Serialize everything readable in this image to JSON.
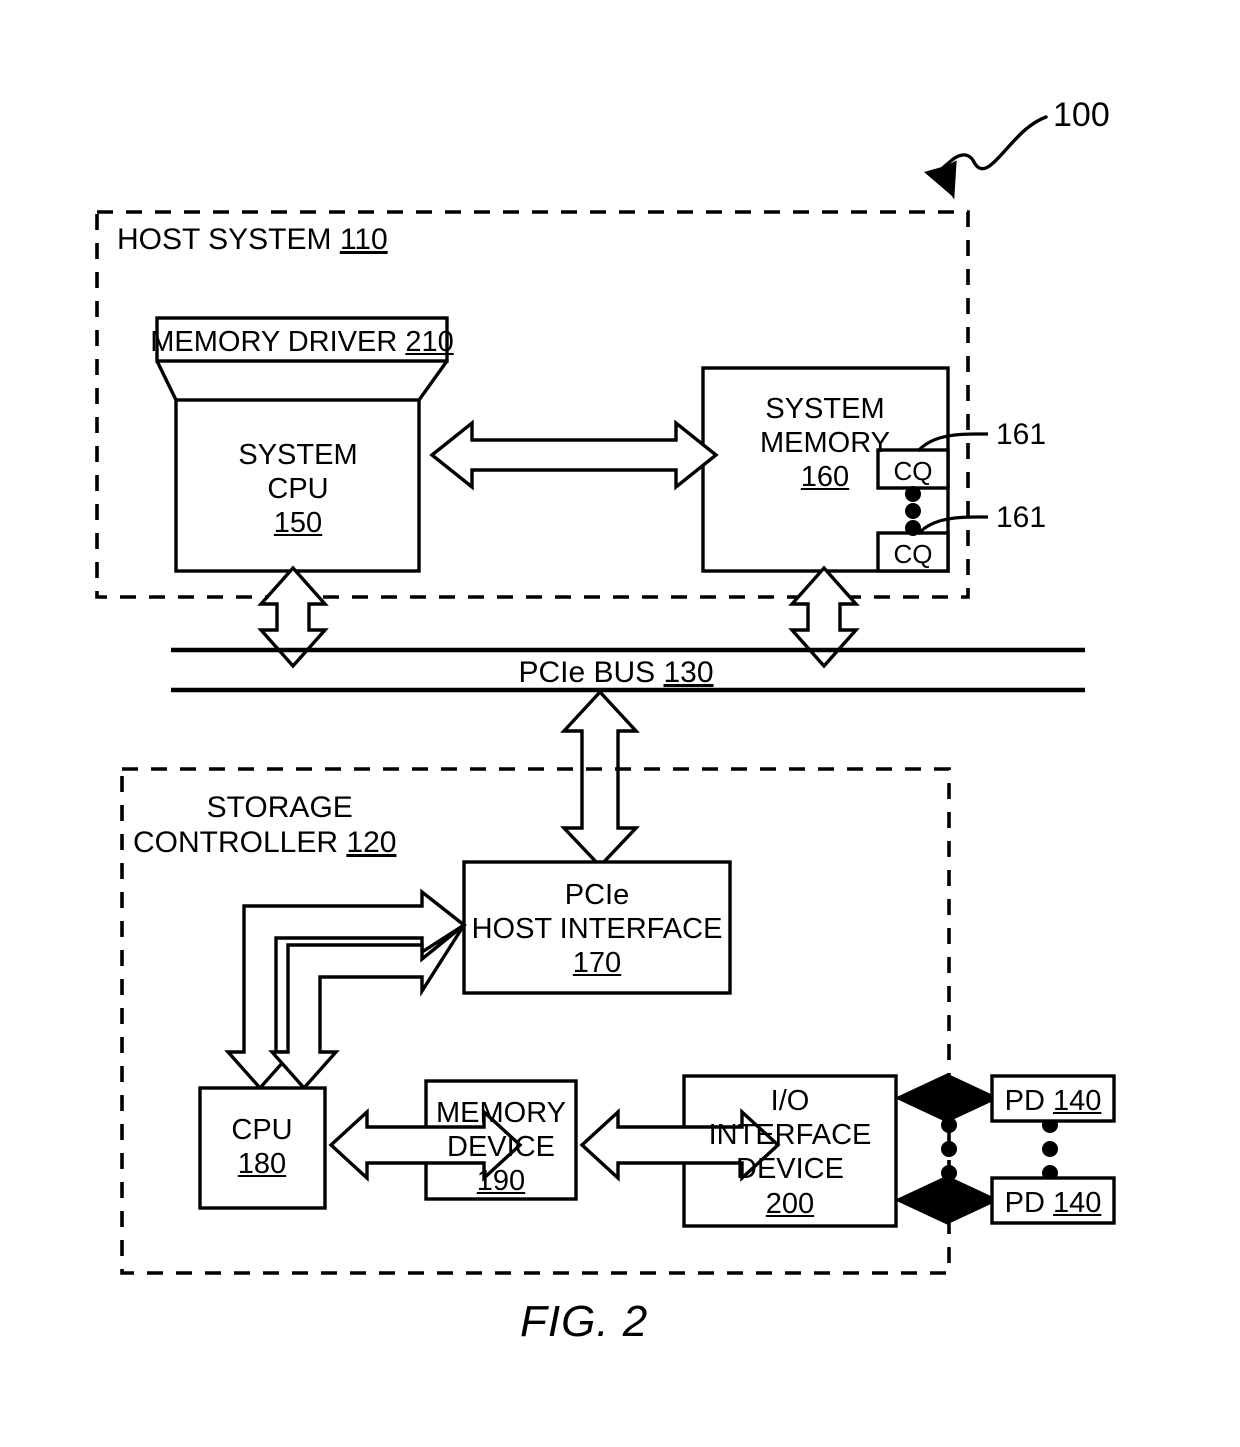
{
  "figure": {
    "caption": "FIG. 2",
    "system_ref": "100"
  },
  "host_system": {
    "label": "HOST SYSTEM",
    "ref": "110",
    "memory_driver": {
      "label": "MEMORY DRIVER",
      "ref": "210"
    },
    "system_cpu": {
      "line1": "SYSTEM",
      "line2": "CPU",
      "ref": "150"
    },
    "system_memory": {
      "line1": "SYSTEM",
      "line2": "MEMORY",
      "ref": "160",
      "queues": [
        {
          "label": "CQ",
          "ref": "161"
        },
        {
          "label": "CQ",
          "ref": "161"
        }
      ],
      "ellipsis": "•"
    }
  },
  "bus": {
    "label": "PCIe BUS",
    "ref": "130"
  },
  "storage_controller": {
    "line1": "STORAGE",
    "line2": "CONTROLLER",
    "ref": "120",
    "pcie_host_interface": {
      "line1": "PCIe",
      "line2": "HOST INTERFACE",
      "ref": "170"
    },
    "cpu": {
      "label": "CPU",
      "ref": "180"
    },
    "memory_device": {
      "line1": "MEMORY",
      "line2": "DEVICE",
      "ref": "190"
    },
    "io_interface_device": {
      "line1": "I/O",
      "line2": "INTERFACE",
      "line3": "DEVICE",
      "ref": "200"
    }
  },
  "physical_devices": [
    {
      "label": "PD",
      "ref": "140"
    },
    {
      "label": "PD",
      "ref": "140"
    }
  ],
  "colors": {
    "stroke": "#000000",
    "background": "#ffffff"
  }
}
